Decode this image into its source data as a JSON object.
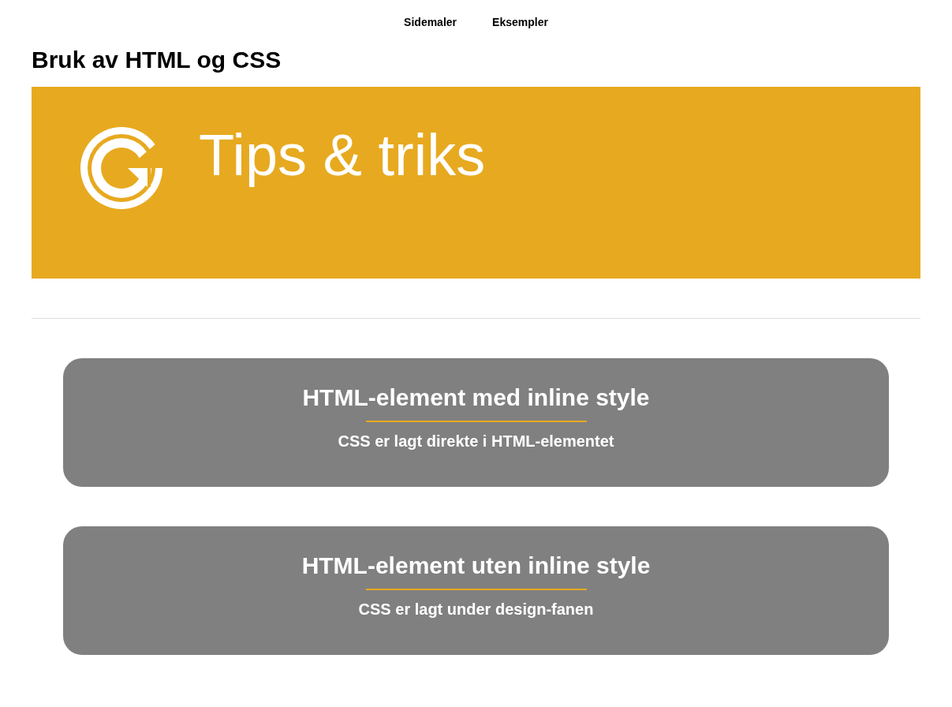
{
  "nav": {
    "items": [
      {
        "label": "Sidemaler"
      },
      {
        "label": "Eksempler"
      }
    ]
  },
  "page_title": "Bruk av HTML og CSS",
  "banner": {
    "title": "Tips & triks"
  },
  "cards": [
    {
      "title": "HTML-element med inline style",
      "subtitle": "CSS er lagt direkte i HTML-elementet"
    },
    {
      "title": "HTML-element uten inline style",
      "subtitle": "CSS er lagt under design-fanen"
    }
  ]
}
